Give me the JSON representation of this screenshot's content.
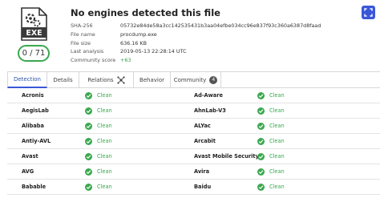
{
  "file": {
    "icon_label": "EXE",
    "title": "No engines detected this file",
    "score": "0 / 71",
    "metadata": [
      {
        "key": "SHA-256",
        "value": "05732e84de58a3cc142535431b3aa04efbe034cc96e837f93c360a6387d8faad"
      },
      {
        "key": "File name",
        "value": "procdump.exe"
      },
      {
        "key": "File size",
        "value": "636.16 KB"
      },
      {
        "key": "Last analysis",
        "value": "2019-05-13 22:28:14 UTC"
      },
      {
        "key": "Community score",
        "value": "+63"
      }
    ]
  },
  "tabs": [
    {
      "label": "Detection"
    },
    {
      "label": "Details"
    },
    {
      "label": "Relations"
    },
    {
      "label": "Behavior"
    },
    {
      "label": "Community",
      "badge": "4"
    }
  ],
  "results": [
    {
      "engine": "Acronis",
      "result": "Clean"
    },
    {
      "engine": "Ad-Aware",
      "result": "Clean"
    },
    {
      "engine": "AegisLab",
      "result": "Clean"
    },
    {
      "engine": "AhnLab-V3",
      "result": "Clean"
    },
    {
      "engine": "Alibaba",
      "result": "Clean"
    },
    {
      "engine": "ALYac",
      "result": "Clean"
    },
    {
      "engine": "Antiy-AVL",
      "result": "Clean"
    },
    {
      "engine": "Arcabit",
      "result": "Clean"
    },
    {
      "engine": "Avast",
      "result": "Clean"
    },
    {
      "engine": "Avast Mobile Security",
      "result": "Clean"
    },
    {
      "engine": "AVG",
      "result": "Clean"
    },
    {
      "engine": "Avira",
      "result": "Clean"
    },
    {
      "engine": "Babable",
      "result": "Clean"
    },
    {
      "engine": "Baidu",
      "result": "Clean"
    }
  ],
  "colors": {
    "accent": "#3a57d8",
    "clean": "#3aa84f"
  }
}
